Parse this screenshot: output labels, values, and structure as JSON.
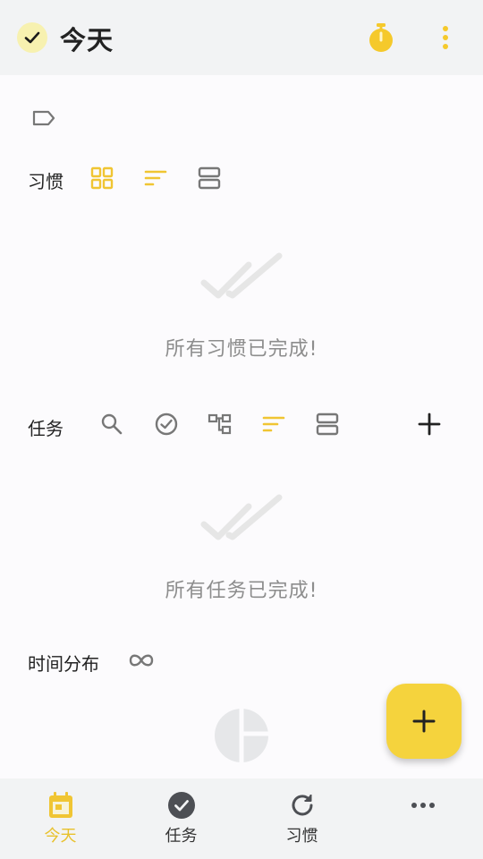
{
  "header": {
    "title": "今天"
  },
  "habits": {
    "label": "习惯",
    "empty_text": "所有习惯已完成!"
  },
  "tasks": {
    "label": "任务",
    "empty_text": "所有任务已完成!"
  },
  "time_distribution": {
    "label": "时间分布"
  },
  "bottom_nav": {
    "items": [
      {
        "label": "今天",
        "icon": "calendar-icon",
        "active": true
      },
      {
        "label": "任务",
        "icon": "check-circle-icon",
        "active": false
      },
      {
        "label": "习惯",
        "icon": "refresh-icon",
        "active": false
      },
      {
        "label": "",
        "icon": "more-horizontal-icon",
        "active": false
      }
    ]
  },
  "colors": {
    "accent": "#f5d33d",
    "icon_gray": "#777777",
    "app_bar": "#f2f3f4",
    "empty_text": "#8d8d8d"
  }
}
